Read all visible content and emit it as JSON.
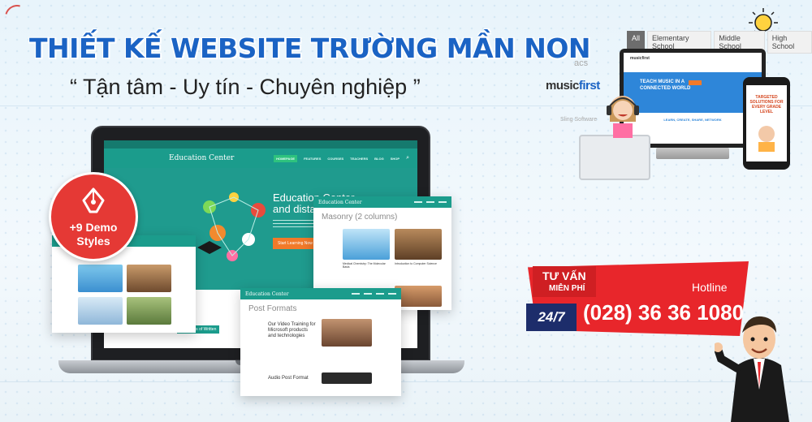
{
  "heading": {
    "title": "THIẾT KẾ WEBSITE TRƯỜNG MẦN NON",
    "slogan": "“ Tận tâm - Uy tín - Chuyên nghiệp ”"
  },
  "badge": {
    "line1": "+9 Demo",
    "line2": "Styles",
    "icon": "pen-nib-icon"
  },
  "laptop_site": {
    "logo": "Education Center",
    "nav": [
      "HOMEPAGE",
      "FEATURES",
      "COURSES",
      "TEACHERS",
      "BLOG",
      "SHOP"
    ],
    "hero_title_1": "Education Center",
    "hero_title_2": "and distance education",
    "hero_button": "Start Learning Now",
    "bottom_caption": "Principles of Written"
  },
  "card_masonry": {
    "logo": "Education Center",
    "title": "Masonry (2 columns)",
    "post1": "Medical Chemistry: The Molecular Basis",
    "post2": "Introduction to Computer Science"
  },
  "card_postformats": {
    "logo": "Education Center",
    "title": "Post Formats",
    "post1": "Our Video Training for Microsoft products and technologies",
    "post2": "Audio Post Format"
  },
  "right_mockup": {
    "filters": [
      "All",
      "Elementary School",
      "Middle School",
      "High School"
    ],
    "active_filter": "All",
    "brand_music_1": "music",
    "brand_music_2": "first",
    "brand_acs": "acs",
    "brand_sling": "Sling Software",
    "monitor_brand": "musicfirst",
    "monitor_hero": "TEACH MUSIC IN A CONNECTED WORLD",
    "monitor_tagline": "LEARN, CREATE, SHARE, NETWORK",
    "phone_title": "TARGETED SOLUTIONS FOR EVERY GRADE LEVEL"
  },
  "hotline": {
    "tuvan": "TƯ VẤN",
    "mienphi": "MIỄN PHÍ",
    "label": "Hotline",
    "tag": "24/7",
    "number": "(028) 36 36 1080"
  },
  "colors": {
    "title_blue": "#1b63c4",
    "teal": "#1b9c8c",
    "badge_red": "#e53935",
    "ribbon_red": "#e8262b",
    "navy": "#1d2d6b"
  }
}
